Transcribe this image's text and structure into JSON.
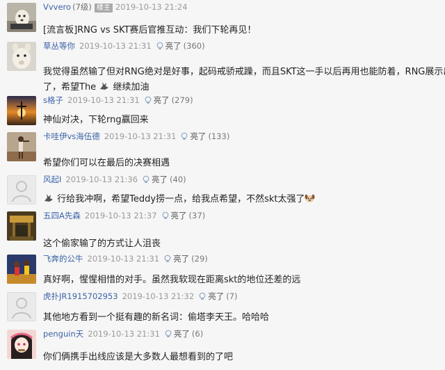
{
  "thread": {
    "op": {
      "user": "Vvvero",
      "level": "(7级)",
      "badge": "楼主",
      "time": "2019-10-13 21:24",
      "content": "[流言板]RNG vs SKT赛后官推互动：我们下轮再见！"
    },
    "light_label": "亮了",
    "replies": [
      {
        "user": "草丛等你",
        "time": "2019-10-13 21:31",
        "count": "(360)",
        "content_a": "我觉得虽然输了但对RNG绝对是好事，起码戒骄戒躁，而且SKT这一手以后再用也能防着，RNG展示出",
        "content_b": "了，希望The",
        "content_c": "继续加油"
      },
      {
        "user": "s格子",
        "time": "2019-10-13 21:31",
        "count": "(279)",
        "content": "神仙对决，下轮rng赢回来"
      },
      {
        "user": "卡哇伊vs海伍德",
        "time": "2019-10-13 21:31",
        "count": "(133)",
        "content": "希望你们可以在最后的决赛相遇"
      },
      {
        "user": "风起I",
        "time": "2019-10-13 21:36",
        "count": "(40)",
        "content_a": "行给我冲啊，希望Teddy捞一点，给我点希望，不然skt太强了"
      },
      {
        "user": "五四A先森",
        "time": "2019-10-13 21:37",
        "count": "(37)",
        "content": "这个偷家输了的方式让人沮丧"
      },
      {
        "user": "飞奔的公牛",
        "time": "2019-10-13 21:31",
        "count": "(29)",
        "content": "真好啊，惺惺相惜的对手。虽然我软现在距离skt的地位还差的远"
      },
      {
        "user": "虎扑JR1915702953",
        "time": "2019-10-13 21:32",
        "count": "(7)",
        "content": "其他地方看到一个挺有趣的新名词：偷塔李天王。哈哈哈"
      },
      {
        "user": "penguin天",
        "time": "2019-10-13 21:31",
        "count": "(6)",
        "content": "你们俩携手出线应该是大多数人最想看到的了吧"
      }
    ]
  },
  "icons": {
    "bulb": "lightbulb-icon",
    "rabbit": "rabbit-icon",
    "dog": "dog-face-emoji"
  },
  "colors": {
    "username": "#3b63a8",
    "badge_bg": "#a9a9a9",
    "background": "#f6f6f6"
  }
}
